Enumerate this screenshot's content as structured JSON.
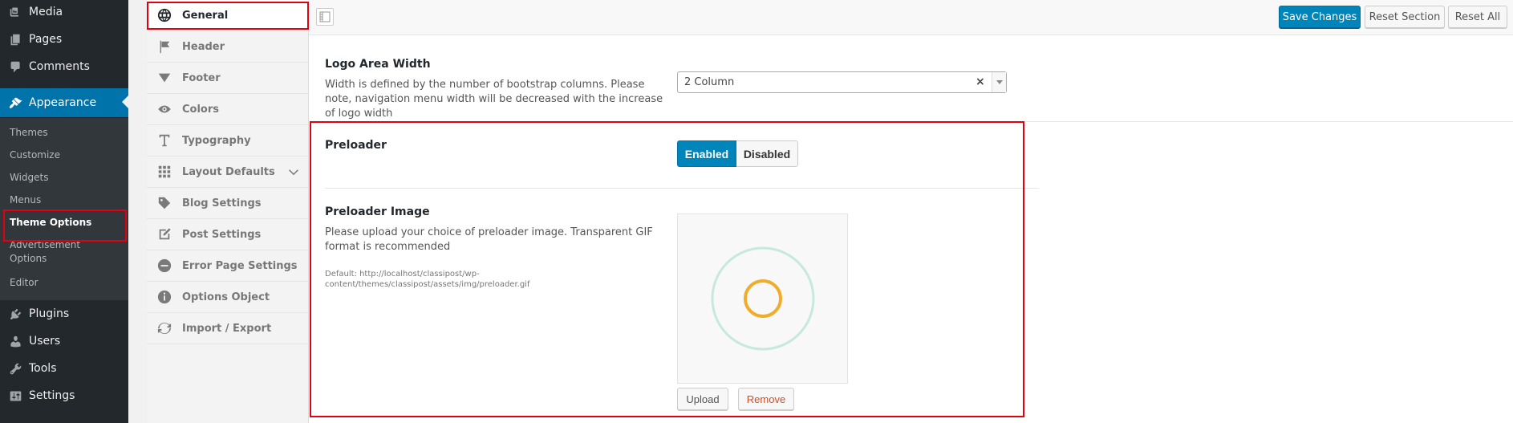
{
  "wp_menu": {
    "items": [
      {
        "label": "Media",
        "icon": "media-icon"
      },
      {
        "label": "Pages",
        "icon": "pages-icon"
      },
      {
        "label": "Comments",
        "icon": "comments-icon"
      },
      {
        "label": "Appearance",
        "icon": "appearance-icon",
        "active": true
      },
      {
        "label": "Plugins",
        "icon": "plugins-icon"
      },
      {
        "label": "Users",
        "icon": "users-icon"
      },
      {
        "label": "Tools",
        "icon": "tools-icon"
      },
      {
        "label": "Settings",
        "icon": "settings-icon"
      }
    ],
    "submenu": [
      {
        "label": "Themes"
      },
      {
        "label": "Customize"
      },
      {
        "label": "Widgets"
      },
      {
        "label": "Menus"
      },
      {
        "label": "Theme Options",
        "current": true
      },
      {
        "label": "Advertisement Options"
      },
      {
        "label": "Editor"
      }
    ]
  },
  "options_nav": {
    "items": [
      {
        "label": "General",
        "icon": "globe-icon",
        "active": true
      },
      {
        "label": "Header",
        "icon": "flag-icon"
      },
      {
        "label": "Footer",
        "icon": "triangle-down-icon"
      },
      {
        "label": "Colors",
        "icon": "eye-icon"
      },
      {
        "label": "Typography",
        "icon": "text-icon"
      },
      {
        "label": "Layout Defaults",
        "icon": "grid-icon",
        "expandable": true
      },
      {
        "label": "Blog Settings",
        "icon": "tag-icon"
      },
      {
        "label": "Post Settings",
        "icon": "edit-icon"
      },
      {
        "label": "Error Page Settings",
        "icon": "minus-circle-icon"
      },
      {
        "label": "Options Object",
        "icon": "info-icon"
      },
      {
        "label": "Import / Export",
        "icon": "refresh-icon"
      }
    ]
  },
  "toolbar": {
    "save_label": "Save Changes",
    "reset_section_label": "Reset Section",
    "reset_all_label": "Reset All"
  },
  "fields": {
    "logo_width": {
      "title": "Logo Area Width",
      "description": "Width is defined by the number of bootstrap columns. Please note, navigation menu width will be decreased with the increase of logo width",
      "value": "2 Column",
      "clear_symbol": "×"
    },
    "preloader": {
      "title": "Preloader",
      "enabled_label": "Enabled",
      "disabled_label": "Disabled",
      "state": "enabled"
    },
    "preloader_image": {
      "title": "Preloader Image",
      "description": "Please upload your choice of preloader image. Transparent GIF format is recommended",
      "default_text": "Default: http://localhost/classipost/wp-content/themes/classipost/assets/img/preloader.gif",
      "upload_label": "Upload",
      "remove_label": "Remove"
    }
  },
  "colors": {
    "wp_sidebar": "#23282d",
    "wp_accent": "#0073aa",
    "primary_button": "#0085ba",
    "highlight": "#e3000f",
    "remove_text": "#d54e21",
    "preloader_outer": "#c7e8df",
    "preloader_inner": "#f0ad2b"
  }
}
